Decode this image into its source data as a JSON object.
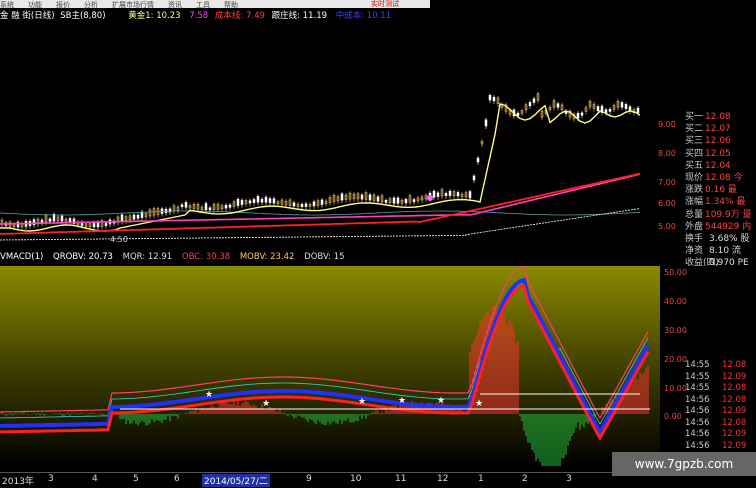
{
  "menu": [
    "系统",
    "功能",
    "报价",
    "分析",
    "扩展市场行情",
    "资讯",
    "工具",
    "帮助"
  ],
  "menu_title": "实时测试",
  "main_header": {
    "name": "金 融 街(日线)",
    "pct_label": "SB主(8,80)",
    "gold_label": "黄金1: 10.23",
    "mid_value": "7.58",
    "cost_label": "成本线: 7.49",
    "follow_label": "跟庄线: 11.19",
    "mid_cost_label": "中成本: 10.11"
  },
  "price_axis": [
    "9.00",
    "8.00",
    "7.00",
    "6.00",
    "5.00"
  ],
  "price_low_label": "4.50",
  "quote": {
    "rows": [
      {
        "k": "买一",
        "v": "12.08"
      },
      {
        "k": "买二",
        "v": "12.07"
      },
      {
        "k": "买三",
        "v": "12.06"
      },
      {
        "k": "买四",
        "v": "12.05"
      },
      {
        "k": "买五",
        "v": "12.04"
      },
      {
        "k": "现价",
        "v": "12.08 今"
      },
      {
        "k": "涨跌",
        "v": "0.16 最"
      },
      {
        "k": "涨幅",
        "v": "1.34% 最"
      },
      {
        "k": "总量",
        "v": "109.9万 量"
      },
      {
        "k": "外盘",
        "v": "544929 内"
      },
      {
        "k": "换手",
        "v": "3.68% 股"
      },
      {
        "k": "净资",
        "v": "8.10 流"
      },
      {
        "k": "收益(四)",
        "v": "0.970 PE"
      }
    ],
    "ticks": [
      {
        "t": "14:55",
        "p": "12.08"
      },
      {
        "t": "14:55",
        "p": "12.09"
      },
      {
        "t": "14:55",
        "p": "12.08"
      },
      {
        "t": "14:56",
        "p": "12.08"
      },
      {
        "t": "14:56",
        "p": "12.09"
      },
      {
        "t": "14:56",
        "p": "12.08"
      },
      {
        "t": "14:56",
        "p": "12.09"
      },
      {
        "t": "14:56",
        "p": "12.09"
      },
      {
        "t": "14:56",
        "p": "12.08"
      },
      {
        "t": "14:56",
        "p": "12.09"
      },
      {
        "t": "14:56",
        "p": "12.09"
      }
    ]
  },
  "indicator": {
    "name": "VMACD(1)",
    "qrobv": "QROBV: 20.73",
    "mqr": "MQR: 12.91",
    "obc": "OBC: 30.38",
    "mobv": "MOBV: 23.42",
    "dobv": "DOBV: 15",
    "axis": [
      "50.00",
      "40.00",
      "30.00",
      "20.00",
      "10.00",
      "0.00"
    ]
  },
  "xaxis": {
    "labels": [
      "2013年",
      "3",
      "4",
      "5",
      "6",
      "7",
      "8",
      "9",
      "10",
      "11",
      "12",
      "1",
      "2",
      "3"
    ],
    "cursor_date": "2014/05/27/二"
  },
  "watermark": "www.7gpzb.com",
  "colors": {
    "up": "#ff3030",
    "down": "#00c0c0",
    "gold": "#ffff80",
    "pink": "#ff40c0",
    "blue": "#2030ff"
  }
}
